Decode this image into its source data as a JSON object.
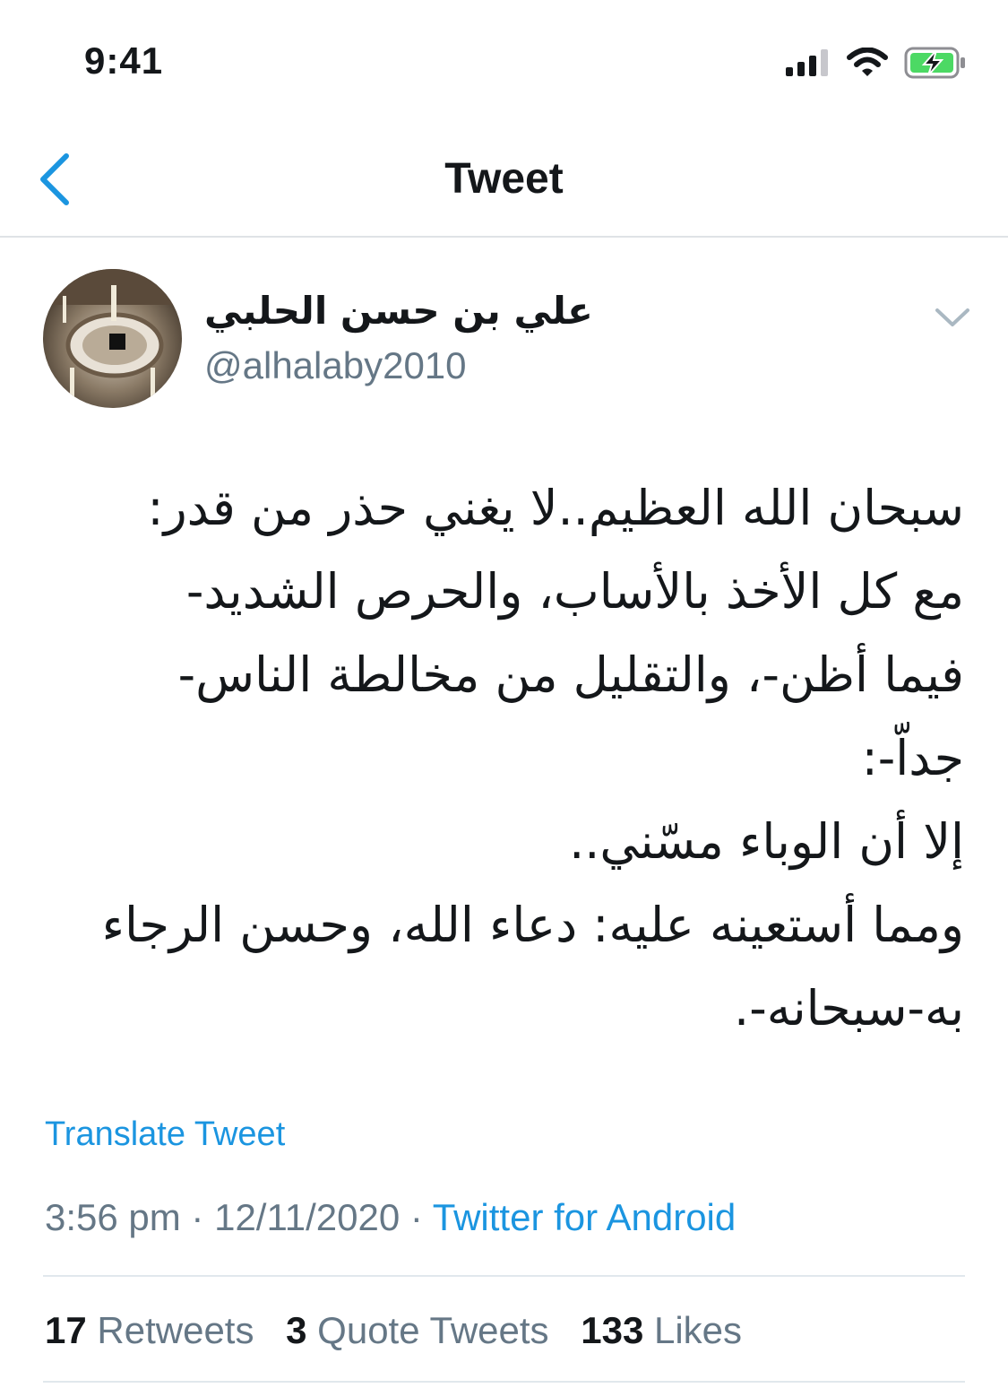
{
  "status_bar": {
    "time": "9:41",
    "icons": [
      "cellular-signal-icon",
      "wifi-icon",
      "battery-charging-icon"
    ],
    "battery_color": "#4cd964"
  },
  "nav": {
    "title": "Tweet",
    "back_icon": "chevron-left-icon",
    "accent_color": "#1b95e0"
  },
  "tweet": {
    "author": {
      "name": "علي بن حسن الحلبي",
      "handle": "@alhalaby2010"
    },
    "text_lines": [
      "سبحان الله العظيم..لا يغني حذر من قدر:",
      "مع كل الأخذ بالأساب، والحرص الشديد-",
      "فيما أظن-، والتقليل من مخالطة الناس-",
      "جداّ-:",
      "إلا أن الوباء مسّني..",
      "ومما أستعينه عليه: دعاء الله، وحسن الرجاء",
      "به-سبحانه-."
    ],
    "translate_label": "Translate Tweet",
    "time": "3:56 pm",
    "separator": " · ",
    "date": "12/11/2020",
    "source": "Twitter for Android",
    "stats": {
      "retweets": {
        "count": "17",
        "label": "Retweets"
      },
      "quotes": {
        "count": "3",
        "label": "Quote Tweets"
      },
      "likes": {
        "count": "133",
        "label": "Likes"
      }
    }
  }
}
